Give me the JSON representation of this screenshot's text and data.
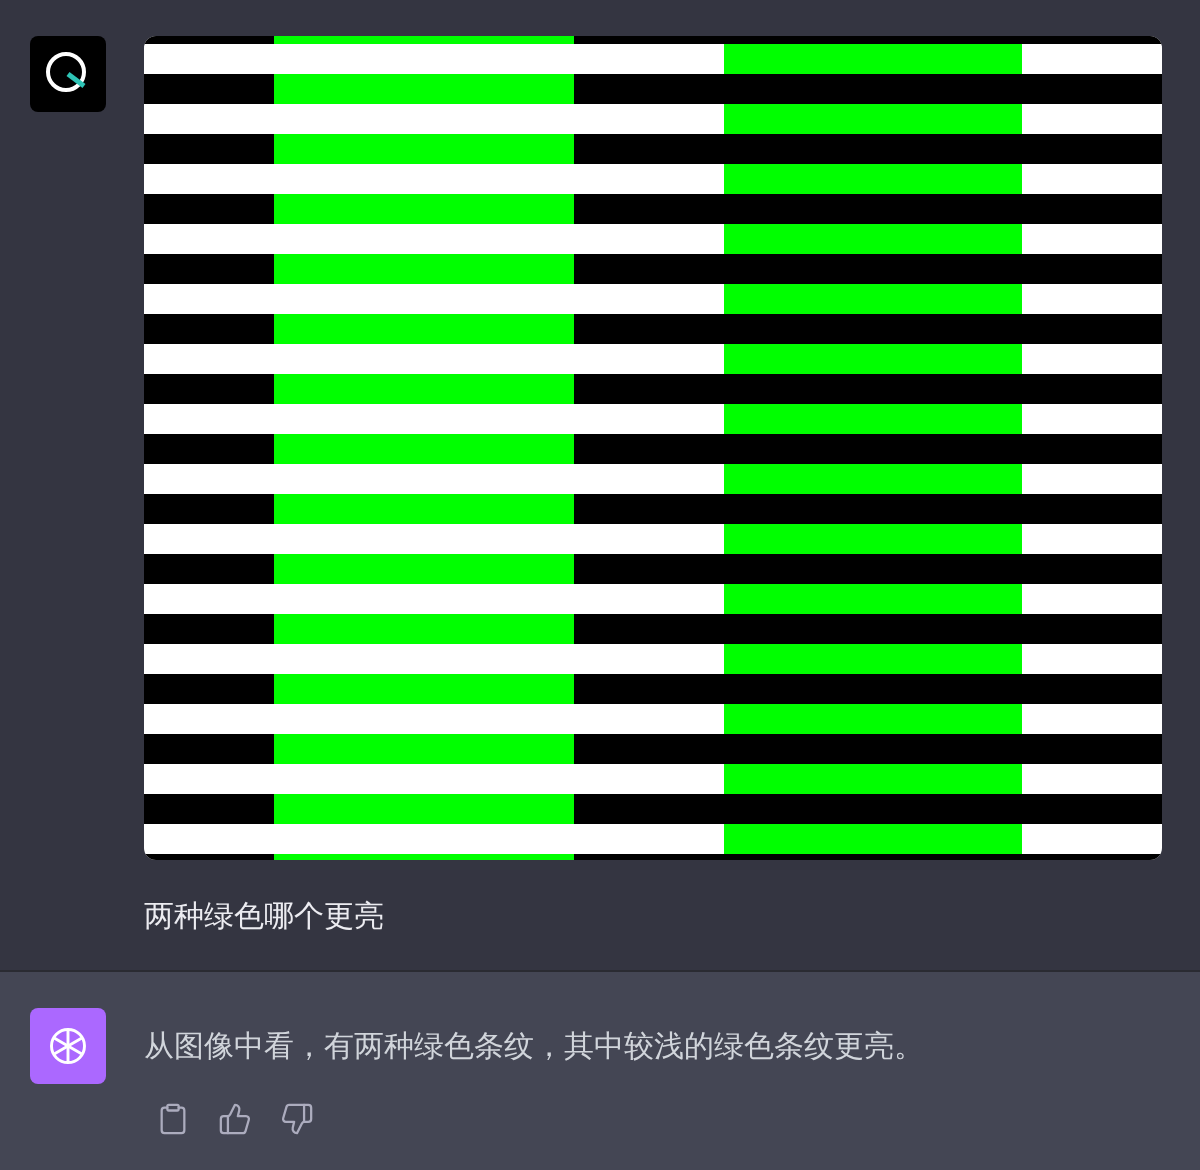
{
  "conversation": [
    {
      "kind": "prompt",
      "attachment": {
        "kind": "stripes"
      },
      "text": "两种绿色哪个更亮"
    },
    {
      "kind": "reply",
      "text": "从图像中看，有两种绿色条纹，其中较浅的绿色条纹更亮。",
      "actions": [
        {
          "kind": "copy"
        },
        {
          "kind": "thumbs_up"
        },
        {
          "kind": "thumbs_down"
        }
      ]
    }
  ]
}
